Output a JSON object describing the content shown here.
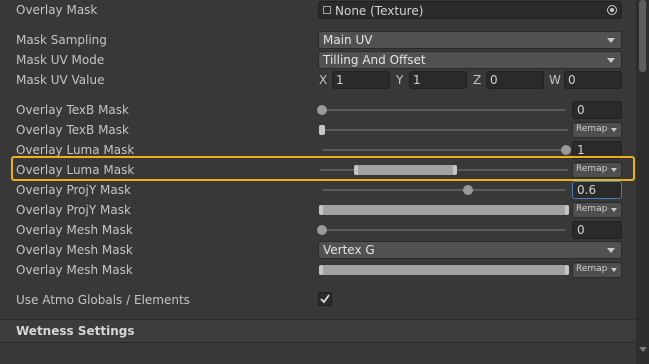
{
  "rows": {
    "overlay_mask": {
      "label": "Overlay Mask",
      "value": "None (Texture)",
      "icon": "texture-icon"
    },
    "mask_sampling": {
      "label": "Mask Sampling",
      "value": "Main UV"
    },
    "mask_uv_mode": {
      "label": "Mask UV Mode",
      "value": "Tilling And Offset"
    },
    "mask_uv_value": {
      "label": "Mask UV Value",
      "x_label": "X",
      "x": "1",
      "y_label": "Y",
      "y": "1",
      "z_label": "Z",
      "z": "0",
      "w_label": "W",
      "w": "0"
    },
    "texb_mask_slider": {
      "label": "Overlay TexB Mask",
      "value": "0",
      "level": 0
    },
    "texb_mask_remap": {
      "label": "Overlay TexB Mask",
      "remap": "Remap",
      "range": [
        0,
        0
      ]
    },
    "luma_mask_slider": {
      "label": "Overlay Luma Mask",
      "value": "1",
      "level": 1
    },
    "luma_mask_remap": {
      "label": "Overlay Luma Mask",
      "remap": "Remap",
      "range": [
        0.14,
        0.55
      ]
    },
    "projy_mask_slider": {
      "label": "Overlay ProjY Mask",
      "value": "0.6",
      "level": 0.6
    },
    "projy_mask_remap": {
      "label": "Overlay ProjY Mask",
      "remap": "Remap",
      "range": [
        0,
        1
      ]
    },
    "mesh_mask_slider": {
      "label": "Overlay Mesh Mask",
      "value": "0",
      "level": 0
    },
    "mesh_mask_channel": {
      "label": "Overlay Mesh Mask",
      "value": "Vertex G"
    },
    "mesh_mask_remap": {
      "label": "Overlay Mesh Mask",
      "remap": "Remap",
      "range": [
        0,
        1
      ]
    },
    "use_atmo": {
      "label": "Use Atmo Globals / Elements",
      "checked": true
    }
  },
  "section": {
    "title": "Wetness Settings"
  },
  "colors": {
    "highlight": "#e8b21c",
    "active_field": "#4a7ab8",
    "background": "#383838"
  }
}
